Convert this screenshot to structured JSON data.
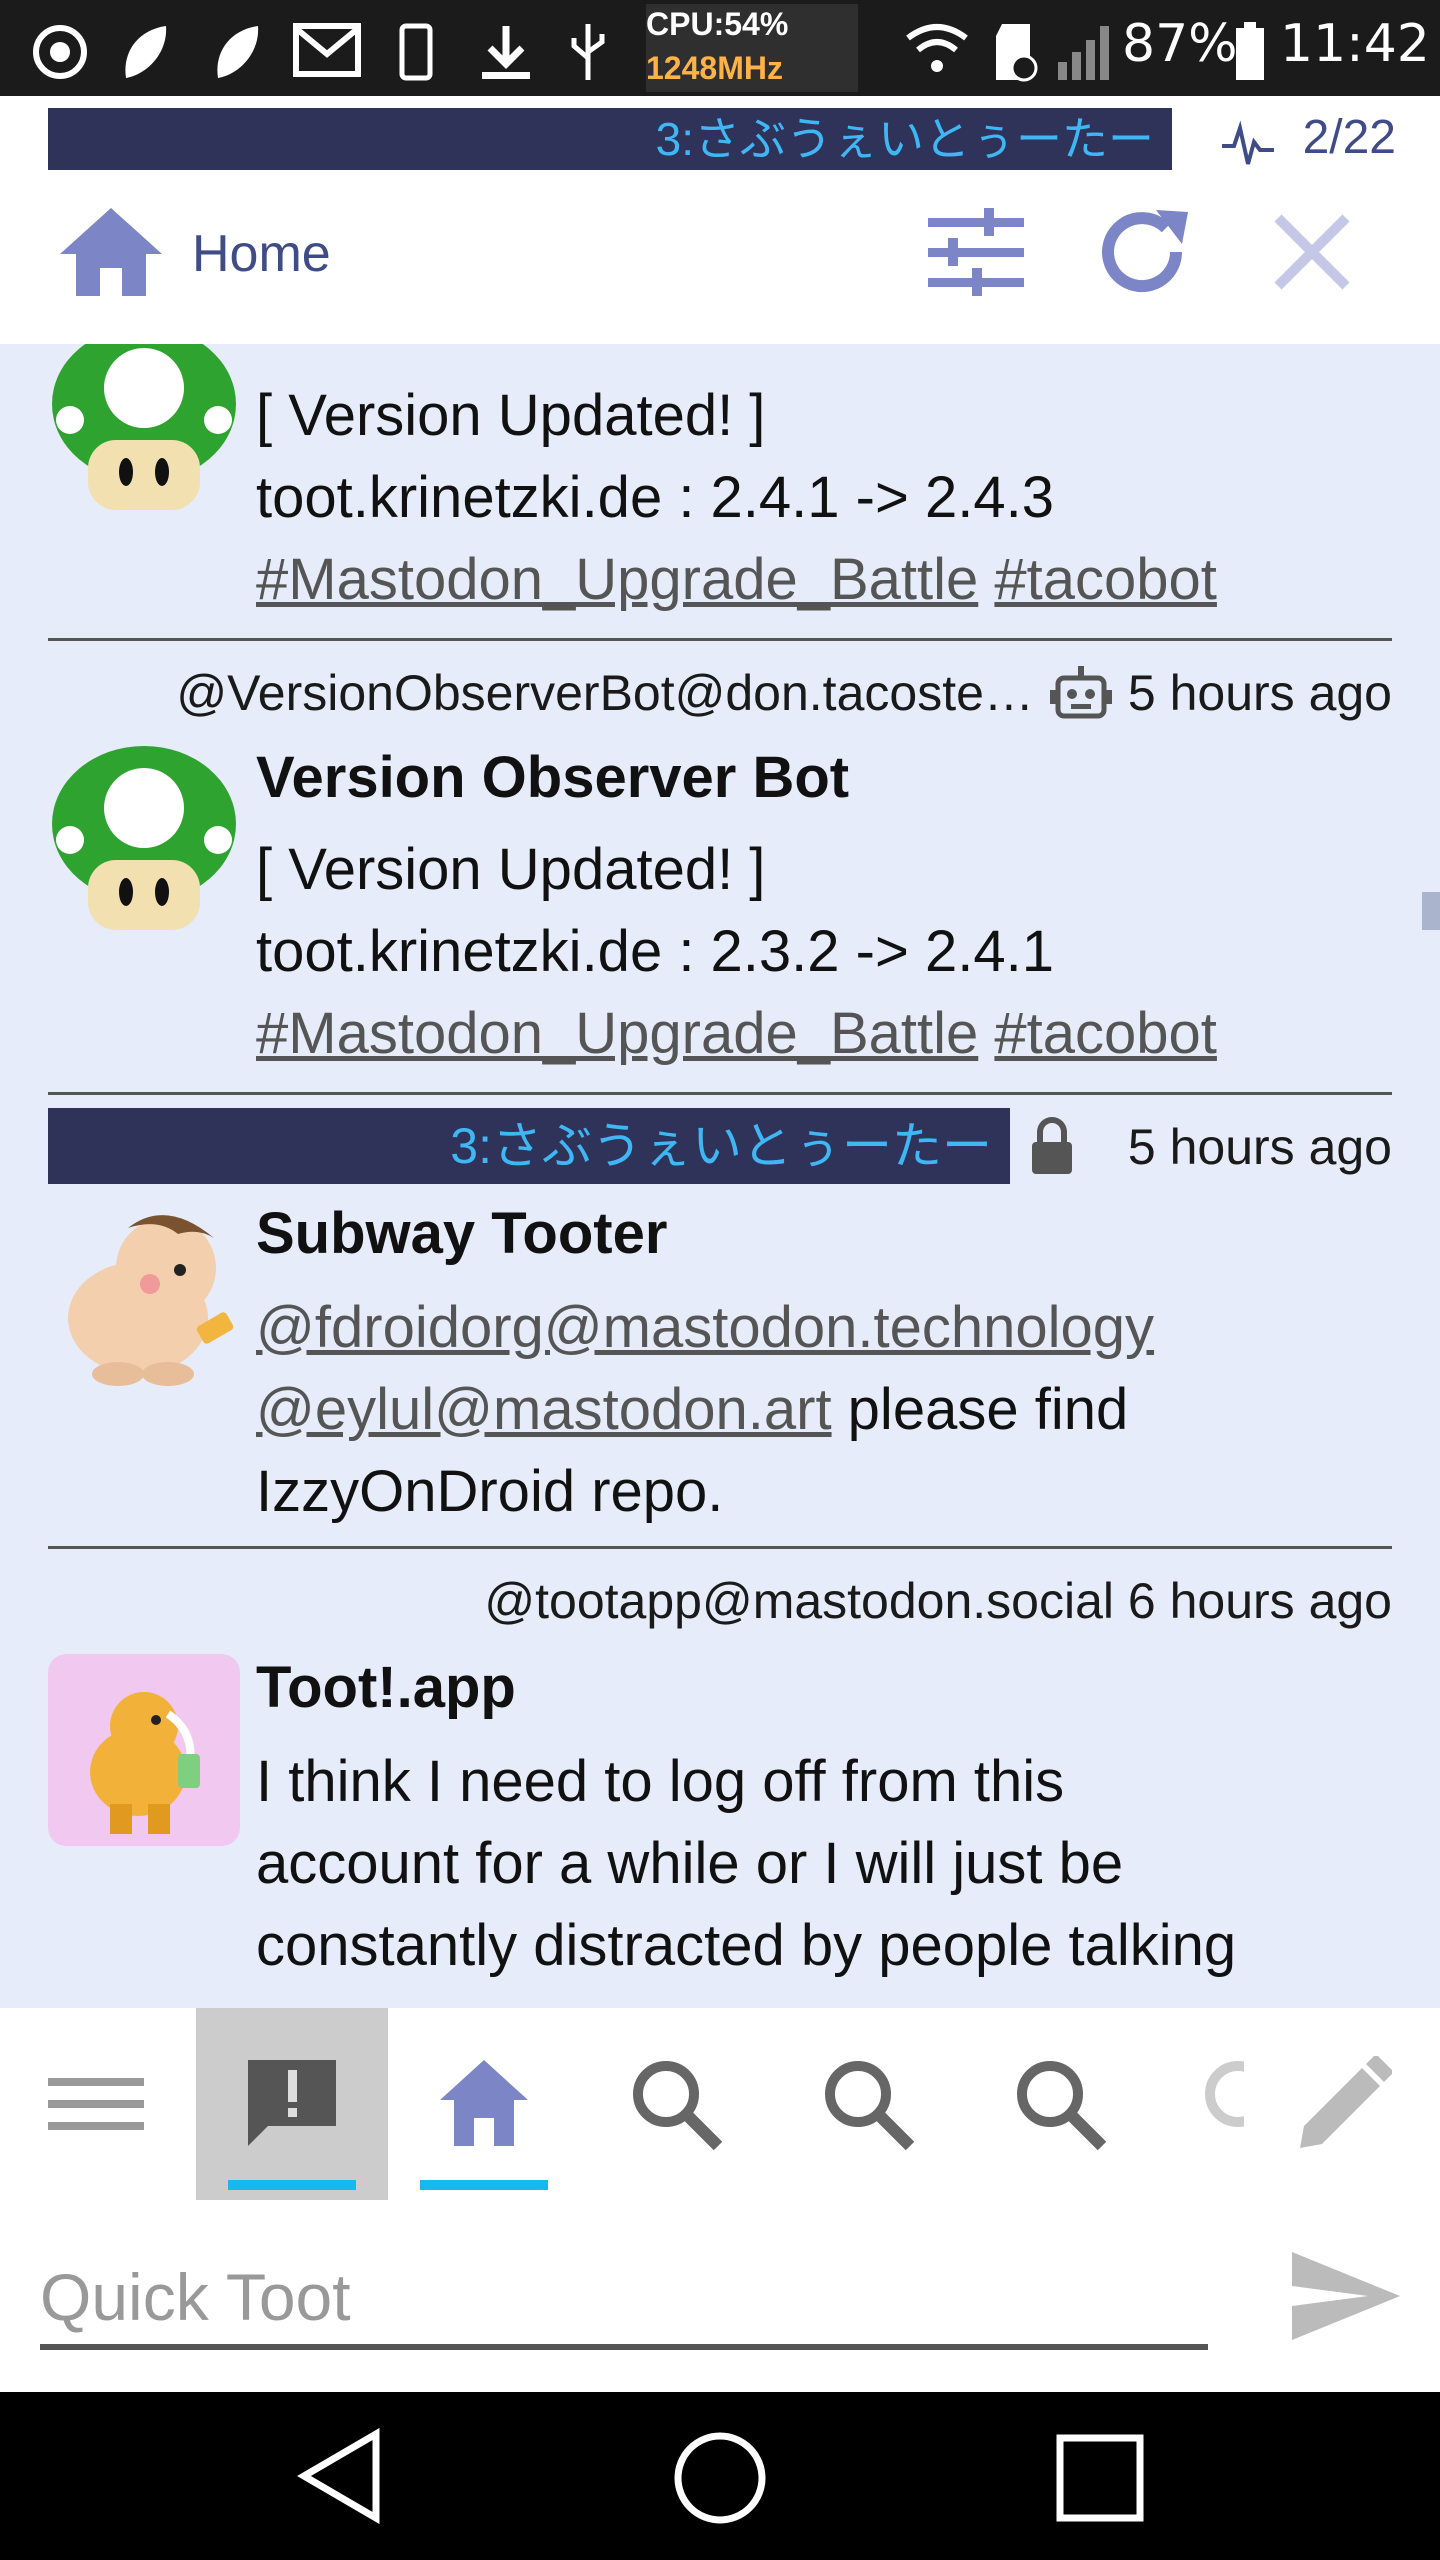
{
  "status_bar": {
    "cpu_label": "CPU:54%",
    "cpu_freq": "1248MHz",
    "battery": "87%",
    "time": "11:42"
  },
  "column_header": {
    "account_name": "3:さぶうぇいとぅーたー",
    "page_indicator": "2/22",
    "title": "Home"
  },
  "feed": {
    "items": [
      {
        "display_name": "",
        "lines": [
          "[ Version Updated! ]",
          "toot.krinetzki.de : 2.4.1 -> 2.4.3"
        ],
        "hashtags": [
          "#Mastodon_Upgrade_Battle",
          "#tacobot"
        ]
      },
      {
        "acct": "@VersionObserverBot@don.tacoste…",
        "time": "5 hours ago",
        "display_name": "Version Observer Bot",
        "lines": [
          "[ Version Updated! ]",
          "toot.krinetzki.de : 2.3.2 -> 2.4.1"
        ],
        "hashtags": [
          "#Mastodon_Upgrade_Battle",
          "#tacobot"
        ]
      },
      {
        "acct_bar": "3:さぶうぇいとぅーたー",
        "time": "5 hours ago",
        "display_name": "Subway Tooter",
        "mention1": "@fdroidorg@mastodon.technology",
        "mention2": "@eylul@mastodon.art",
        "text_after_mention2": " please find",
        "line3": "IzzyOnDroid repo."
      },
      {
        "acct": "@tootapp@mastodon.social",
        "time": "6 hours ago",
        "display_name": "Toot!.app",
        "lines": [
          "I think I need to log off from this",
          "account for a while or I will just be",
          "constantly distracted by people talking"
        ]
      }
    ]
  },
  "tabs": [
    "menu-icon",
    "notifications-icon",
    "home-icon",
    "search-icon",
    "search-icon",
    "search-icon",
    "partial-icon"
  ],
  "quick_toot": {
    "placeholder": "Quick Toot"
  },
  "colors": {
    "accent": "#18b7f0",
    "account_bar": "#2f3359",
    "account_text": "#3fb7f4",
    "icon_blue": "#7c85c6",
    "feed_bg": "#e6ecf9"
  }
}
